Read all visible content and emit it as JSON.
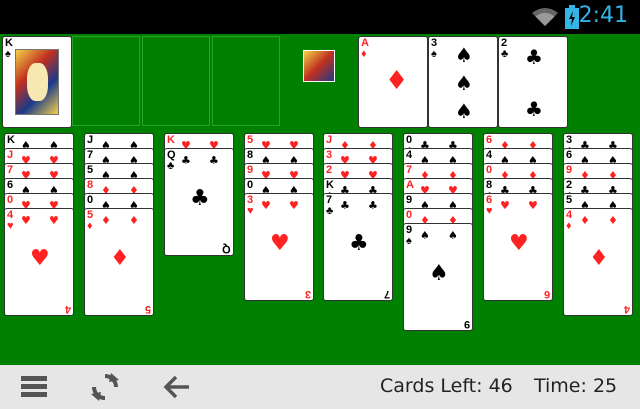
{
  "status": {
    "time": "2:41"
  },
  "footer": {
    "cards_left": "Cards Left: 46",
    "time": "Time: 25"
  },
  "icons": {
    "menu": "menu-icon",
    "restart": "refresh-icon",
    "undo": "back-arrow-icon"
  },
  "colors": {
    "felt": "#008000",
    "red": "#ff2222",
    "black": "#000000",
    "clock": "#33b5e5"
  },
  "top_row": {
    "freecell_card": {
      "rank": "K",
      "suit": "♠"
    },
    "foundations": [
      {
        "rank": "A",
        "suit": "♦"
      },
      {
        "rank": "3",
        "suit": "♠"
      },
      {
        "rank": "2",
        "suit": "♣"
      }
    ]
  },
  "tableau": [
    {
      "cards": [
        [
          "K",
          "♠"
        ],
        [
          "J",
          "♥"
        ],
        [
          "7",
          "♥"
        ],
        [
          "6",
          "♠"
        ],
        [
          "0",
          "♥"
        ],
        [
          "4",
          "♥"
        ]
      ]
    },
    {
      "cards": [
        [
          "J",
          "♠"
        ],
        [
          "7",
          "♠"
        ],
        [
          "5",
          "♠"
        ],
        [
          "8",
          "♦"
        ],
        [
          "0",
          "♠"
        ],
        [
          "5",
          "♦"
        ]
      ]
    },
    {
      "cards": [
        [
          "K",
          "♥"
        ],
        [
          "Q",
          "♣"
        ]
      ]
    },
    {
      "cards": [
        [
          "5",
          "♥"
        ],
        [
          "8",
          "♠"
        ],
        [
          "9",
          "♥"
        ],
        [
          "0",
          "♠"
        ],
        [
          "3",
          "♥"
        ]
      ]
    },
    {
      "cards": [
        [
          "J",
          "♦"
        ],
        [
          "3",
          "♥"
        ],
        [
          "2",
          "♥"
        ],
        [
          "K",
          "♣"
        ],
        [
          "7",
          "♣"
        ]
      ]
    },
    {
      "cards": [
        [
          "0",
          "♣"
        ],
        [
          "4",
          "♠"
        ],
        [
          "7",
          "♦"
        ],
        [
          "A",
          "♥"
        ],
        [
          "9",
          "♠"
        ],
        [
          "0",
          "♦"
        ],
        [
          "9",
          "♠"
        ]
      ]
    },
    {
      "cards": [
        [
          "6",
          "♦"
        ],
        [
          "4",
          "♠"
        ],
        [
          "0",
          "♦"
        ],
        [
          "8",
          "♣"
        ],
        [
          "6",
          "♥"
        ]
      ]
    },
    {
      "cards": [
        [
          "3",
          "♣"
        ],
        [
          "6",
          "♠"
        ],
        [
          "9",
          "♦"
        ],
        [
          "2",
          "♣"
        ],
        [
          "5",
          "♠"
        ],
        [
          "4",
          "♦"
        ]
      ]
    }
  ]
}
